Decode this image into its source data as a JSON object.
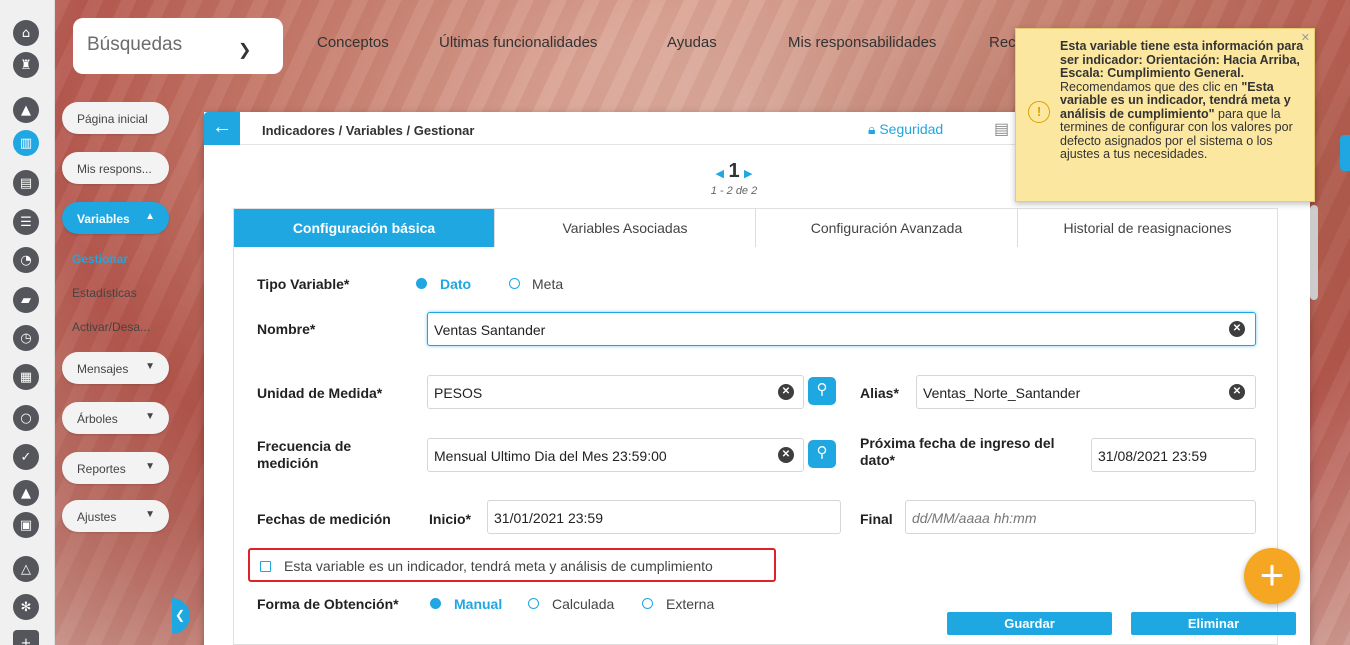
{
  "topbar": {
    "search_label": "Búsquedas",
    "nav": [
      "Conceptos",
      "Últimas funcionalidades",
      "Ayudas",
      "Mis responsabilidades",
      "Rec"
    ]
  },
  "menu": {
    "pagina": "Página inicial",
    "respons": "Mis respons...",
    "variables": "Variables",
    "gestionar": "Gestionar",
    "estadisticas": "Estadísticas",
    "activar": "Activar/Desa...",
    "mensajes": "Mensajes",
    "arboles": "Árboles",
    "reportes": "Reportes",
    "ajustes": "Ajustes"
  },
  "panel": {
    "breadcrumb": "Indicadores / Variables / Gestionar",
    "security": "Seguridad",
    "page": "1",
    "count": "1 - 2 de 2"
  },
  "tabs": [
    "Configuración básica",
    "Variables Asociadas",
    "Configuración Avanzada",
    "Historial de reasignaciones"
  ],
  "form": {
    "tipo_label": "Tipo Variable*",
    "tipo_opt1": "Dato",
    "tipo_opt2": "Meta",
    "nombre_label": "Nombre*",
    "nombre_value": "Ventas Santander",
    "unidad_label": "Unidad de Medida*",
    "unidad_value": "PESOS",
    "alias_label": "Alias*",
    "alias_value": "Ventas_Norte_Santander",
    "frecuencia_label": "Frecuencia de medición",
    "frecuencia_value": "Mensual Ultimo Dia del Mes 23:59:00",
    "proxima_label": "Próxima fecha de ingreso del dato*",
    "proxima_value": "31/08/2021 23:59",
    "fechas_label": "Fechas de medición",
    "inicio_label": "Inicio*",
    "inicio_value": "31/01/2021 23:59",
    "final_label": "Final",
    "final_placeholder": "dd/MM/aaaa hh:mm",
    "indicador_check": "Esta variable es un indicador, tendrá meta y análisis de cumplimiento",
    "forma_label": "Forma de Obtención*",
    "forma_opt1": "Manual",
    "forma_opt2": "Calculada",
    "forma_opt3": "Externa"
  },
  "buttons": {
    "guardar": "Guardar",
    "eliminar": "Eliminar"
  },
  "tooltip": {
    "b1": "Esta variable tiene esta información para ser indicador: Orientación: Hacia Arriba, Escala: Cumplimiento General.",
    "t1": " Recomendamos que des clic en ",
    "b2": "\"Esta variable es un indicador, tendrá meta y análisis de cumplimiento\"",
    "t2": " para que la termines de configurar con los valores por defecto asignados por el sistema o los ajustes a tus necesidades."
  },
  "colors": {
    "accent": "#1ea7e1",
    "fab": "#f5a623",
    "tooltip_bg": "#fbe7a0",
    "highlight": "#e0212a"
  }
}
